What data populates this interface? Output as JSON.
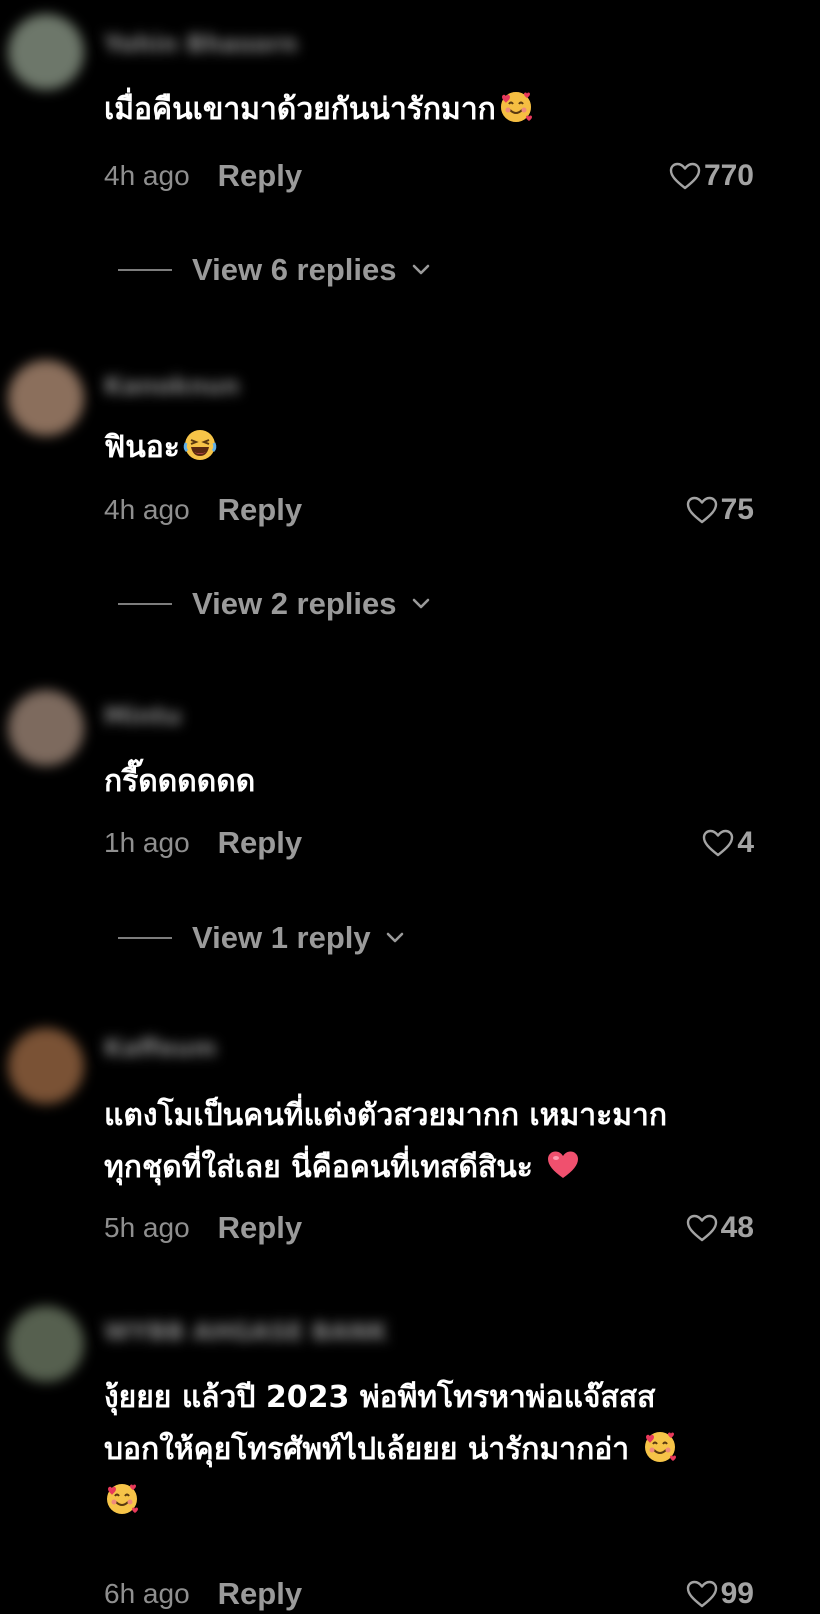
{
  "comments": [
    {
      "username": "Yohin Bhasorn",
      "text": "เมื่อคืนเขามาด้วยกันน่ารักมาก",
      "emoji": "smiling-face-with-hearts",
      "time": "4h ago",
      "reply_label": "Reply",
      "likes": "770",
      "view_replies": "View 6 replies",
      "avatar_color": "#6d776a"
    },
    {
      "username": "Kanoknun",
      "text": "ฟินอะ",
      "emoji": "laughing-face",
      "time": "4h ago",
      "reply_label": "Reply",
      "likes": "75",
      "view_replies": "View 2 replies",
      "avatar_color": "#8b6f5c"
    },
    {
      "username": "Mintu",
      "text": "กรี๊ดดดดดด",
      "time": "1h ago",
      "reply_label": "Reply",
      "likes": "4",
      "view_replies": "View 1 reply",
      "avatar_color": "#7d6a5e"
    },
    {
      "username": "Kaffeum",
      "text_lines": [
        "แตงโมเป็นคนที่แต่งตัวสวยมากก เหมาะมาก",
        "ทุกชุดที่ใส่เลย นี่คือคนที่เทสดีสินะ"
      ],
      "emoji": "heart",
      "time": "5h ago",
      "reply_label": "Reply",
      "likes": "48",
      "avatar_color": "#7a5235"
    },
    {
      "username": "WYBB AHGASE BANK",
      "text_lines": [
        "งุ้ยยย แล้วปี 2023 พ่อพีทโทรหาพ่อแจ๊สสส",
        "บอกให้คุยโทรศัพท์ไปเล้ยยย น่ารักมากอ่า"
      ],
      "emoji": "smiling-face-with-hearts",
      "time": "6h ago",
      "reply_label": "Reply",
      "likes": "99",
      "avatar_color": "#56604f"
    }
  ],
  "icons": {
    "like": "heart-outline-icon",
    "expand": "chevron-down-icon"
  },
  "colors": {
    "background": "#000000",
    "comment_text": "#ffffff",
    "secondary_text": "#8f8f8f"
  }
}
